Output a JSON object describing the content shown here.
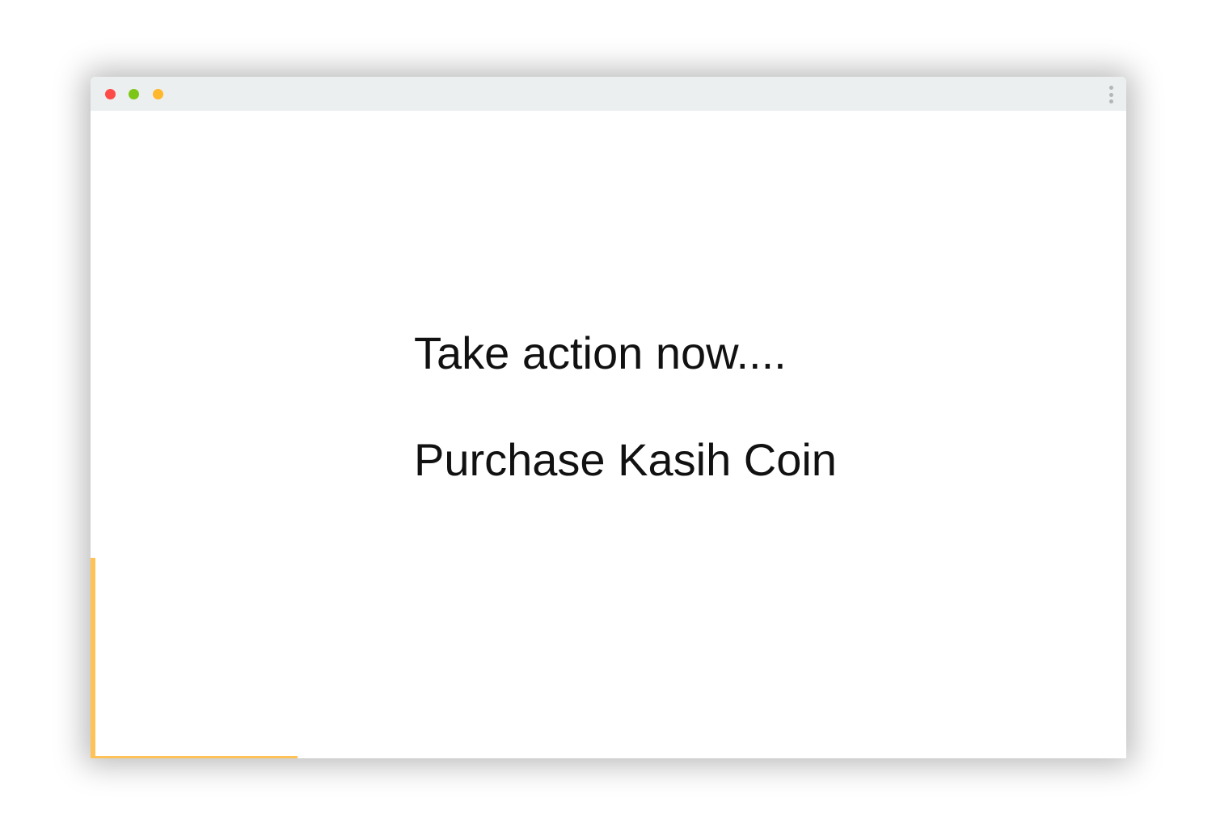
{
  "window": {
    "controls": {
      "close_color": "#ff4b47",
      "minimize_color": "#7dc617",
      "maximize_color": "#ffb72b"
    },
    "menu_icon": "more-vertical-icon"
  },
  "main": {
    "line1": "Take action now....",
    "line2": "Purchase Kasih Coin"
  },
  "colors": {
    "accent": "#ffc257",
    "titlebar": "#eceff0",
    "text": "#111111"
  }
}
